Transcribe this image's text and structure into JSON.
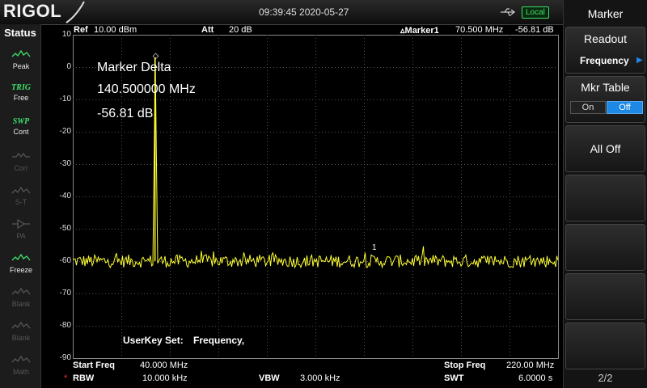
{
  "header": {
    "brand": "RIGOL",
    "datetime": "09:39:45 2020-05-27",
    "local_label": "Local"
  },
  "status": {
    "title": "Status",
    "items": [
      {
        "top": "",
        "label": "Peak",
        "icon": "peak-icon",
        "active": true
      },
      {
        "top": "TRIG",
        "label": "Free",
        "icon": "",
        "active": true
      },
      {
        "top": "SWP",
        "label": "Cont",
        "icon": "",
        "active": true
      },
      {
        "top": "",
        "label": "Corr",
        "icon": "corr-icon",
        "active": false
      },
      {
        "top": "",
        "label": "S-T",
        "icon": "s-t-icon",
        "active": false
      },
      {
        "top": "",
        "label": "PA",
        "icon": "pa-icon",
        "active": false
      },
      {
        "top": "",
        "label": "Freeze",
        "icon": "freeze-icon",
        "active": true
      },
      {
        "top": "",
        "label": "Blank",
        "icon": "blank-icon",
        "active": false
      },
      {
        "top": "",
        "label": "Blank",
        "icon": "blank-icon",
        "active": false
      },
      {
        "top": "",
        "label": "Math",
        "icon": "math-icon",
        "active": false
      }
    ]
  },
  "measure": {
    "ref_label": "Ref",
    "ref_value": "10.00 dBm",
    "att_label": "Att",
    "att_value": "20 dB",
    "marker_label": "Marker1",
    "marker_freq": "70.500 MHz",
    "marker_level": "-56.81 dB",
    "marker_delta_title": "Marker Delta",
    "marker_delta_freq": "140.500000 MHz",
    "marker_delta_level": "-56.81 dB",
    "userkey_label": "UserKey Set:",
    "userkey_value": "Frequency,"
  },
  "footer": {
    "start_label": "Start Freq",
    "start_value": "40.000 MHz",
    "stop_label": "Stop Freq",
    "stop_value": "220.00 MHz",
    "rbw_marker": "*",
    "rbw_label": "RBW",
    "rbw_value": "10.000 kHz",
    "vbw_label": "VBW",
    "vbw_value": "3.000 kHz",
    "swt_label": "SWT",
    "swt_value": "6.0000 s"
  },
  "menu": {
    "title": "Marker",
    "readout_label": "Readout",
    "readout_value": "Frequency",
    "mkr_table_label": "Mkr Table",
    "mkr_table_on": "On",
    "mkr_table_off": "Off",
    "all_off_label": "All Off",
    "page": "2/2"
  },
  "colors": {
    "trace": "#ffff33",
    "accent_blue": "#1e88e5",
    "status_green": "#3fe06a"
  },
  "chart_data": {
    "type": "line",
    "x_unit": "MHz",
    "y_unit": "dBm",
    "xlim": [
      40,
      220
    ],
    "ylim": [
      -90,
      10
    ],
    "yticks": [
      10,
      0,
      -10,
      -20,
      -30,
      -40,
      -50,
      -60,
      -70,
      -80,
      -90
    ],
    "grid": true,
    "noise_floor_db": -60,
    "peak": {
      "x_mhz": 70.5,
      "y_db": 3
    },
    "marker": {
      "label": "1",
      "x_mhz": 151,
      "y_db": -58
    }
  }
}
